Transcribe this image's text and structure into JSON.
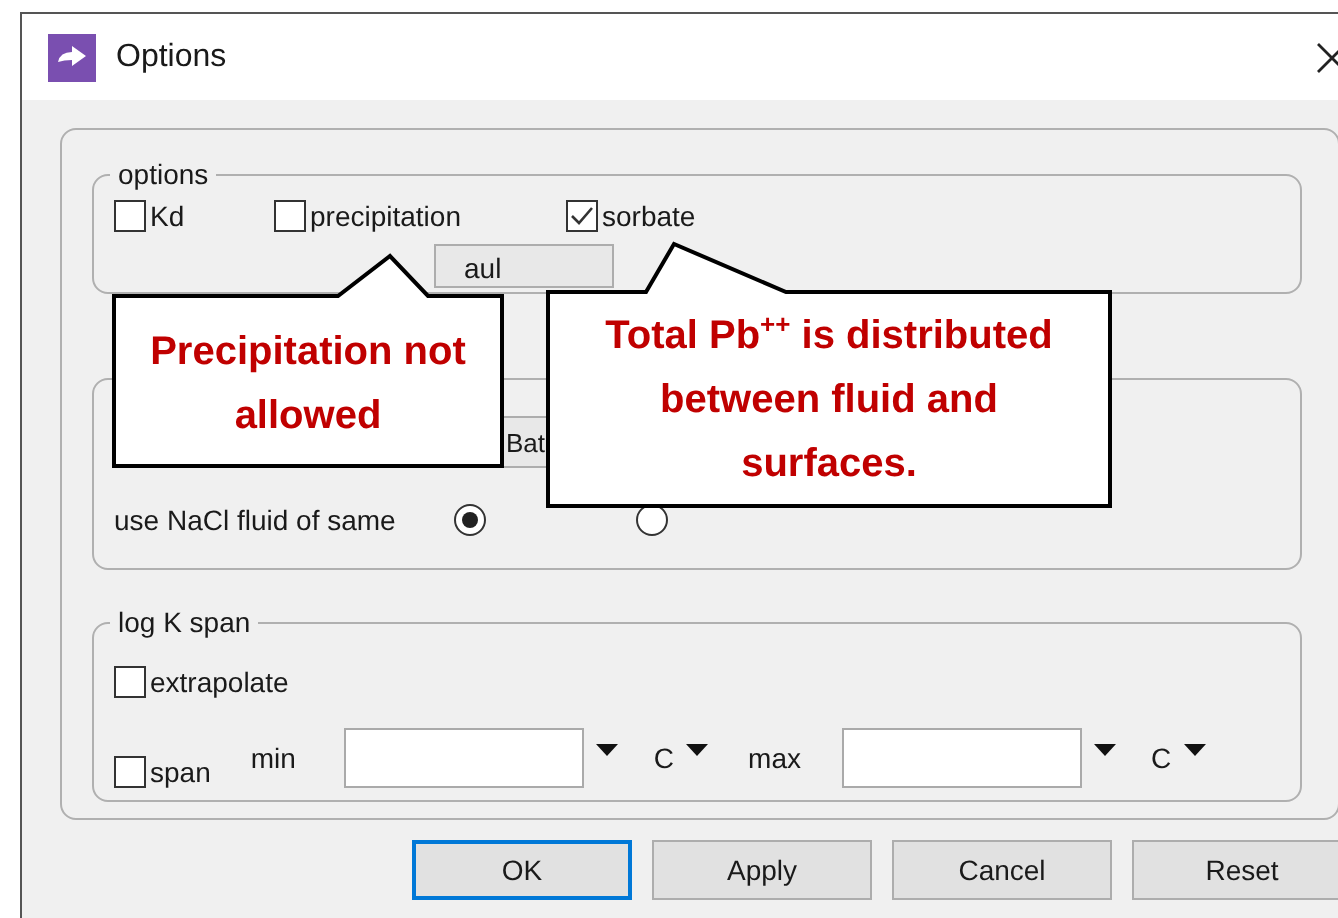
{
  "window": {
    "title": "Options"
  },
  "options_group": {
    "legend": "options",
    "checkboxes": [
      {
        "label": "Kd",
        "checked": false
      },
      {
        "label": "precipitation",
        "checked": false
      },
      {
        "label": "sorbate",
        "checked": true
      }
    ],
    "field": {
      "value": "aul"
    }
  },
  "fluid_group": {
    "field": {
      "value": "Bat"
    },
    "label": "use NaCl fluid of same",
    "radios": [
      {
        "selected": true
      },
      {
        "selected": false
      }
    ]
  },
  "logk_group": {
    "legend": "log K span",
    "extrapolate": {
      "label": "extrapolate",
      "checked": false
    },
    "span": {
      "label": "span",
      "checked": false
    },
    "min_label": "min",
    "min_unit": "C",
    "max_label": "max",
    "max_unit": "C"
  },
  "buttons": [
    {
      "label": "OK",
      "default": true
    },
    {
      "label": "Apply",
      "default": false
    },
    {
      "label": "Cancel",
      "default": false
    },
    {
      "label": "Reset",
      "default": false
    }
  ],
  "callouts": [
    {
      "text": "Precipitation not allowed"
    },
    {
      "text": "Total Pb$^{++}$ is distributed between fluid and surfaces."
    }
  ]
}
